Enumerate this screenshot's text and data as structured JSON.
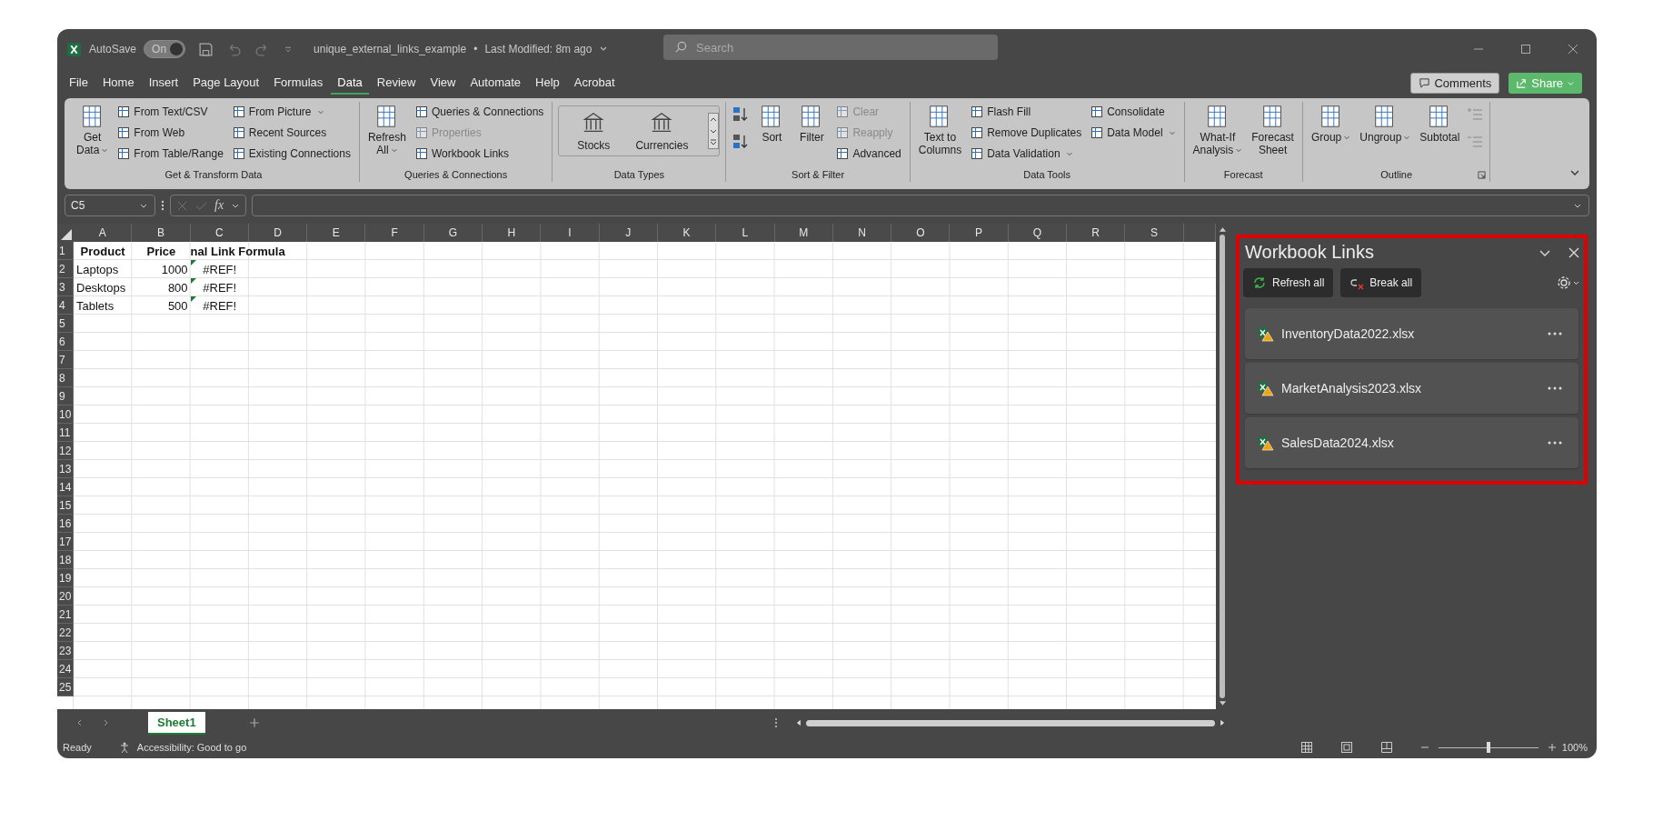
{
  "title_bar": {
    "autosave_label": "AutoSave",
    "autosave": {
      "label": "On",
      "on": true
    },
    "file_name": "unique_external_links_example",
    "separator": "•",
    "modified": "Last Modified: 8m ago",
    "search": {
      "placeholder": "Search"
    }
  },
  "menu_tabs": [
    {
      "label": "File",
      "selected": false
    },
    {
      "label": "Home",
      "selected": false
    },
    {
      "label": "Insert",
      "selected": false
    },
    {
      "label": "Page Layout",
      "selected": false
    },
    {
      "label": "Formulas",
      "selected": false
    },
    {
      "label": "Data",
      "selected": true
    },
    {
      "label": "Review",
      "selected": false
    },
    {
      "label": "View",
      "selected": false
    },
    {
      "label": "Automate",
      "selected": false
    },
    {
      "label": "Help",
      "selected": false
    },
    {
      "label": "Acrobat",
      "selected": false
    }
  ],
  "comments": "Comments",
  "share": "Share",
  "ribbon": [
    {
      "label": "Get & Transform Data",
      "columns": [
        {
          "kind": "large",
          "items": [
            {
              "label": "Get\nData",
              "dropdown": true
            }
          ]
        },
        {
          "kind": "small",
          "items": [
            {
              "label": "From Text/CSV"
            },
            {
              "label": "From Web"
            },
            {
              "label": "From Table/Range"
            }
          ]
        },
        {
          "kind": "small",
          "items": [
            {
              "label": "From Picture",
              "dropdown": true
            },
            {
              "label": "Recent Sources"
            },
            {
              "label": "Existing Connections"
            }
          ]
        }
      ]
    },
    {
      "label": "Queries & Connections",
      "columns": [
        {
          "kind": "large",
          "items": [
            {
              "label": "Refresh\nAll",
              "dropdown": true
            }
          ]
        },
        {
          "kind": "small",
          "items": [
            {
              "label": "Queries & Connections"
            },
            {
              "label": "Properties",
              "disabled": true
            },
            {
              "label": "Workbook Links"
            }
          ]
        }
      ]
    },
    {
      "label": "Data Types",
      "columns": [
        {
          "kind": "gallery",
          "items": [
            {
              "label": "Stocks"
            },
            {
              "label": "Currencies"
            }
          ]
        }
      ]
    },
    {
      "label": "Sort & Filter",
      "columns": [
        {
          "kind": "sort-icons"
        },
        {
          "kind": "large",
          "items": [
            {
              "label": "Sort"
            }
          ]
        },
        {
          "kind": "large",
          "items": [
            {
              "label": "Filter"
            }
          ]
        },
        {
          "kind": "small",
          "items": [
            {
              "label": "Clear",
              "disabled": true
            },
            {
              "label": "Reapply",
              "disabled": true
            },
            {
              "label": "Advanced"
            }
          ]
        }
      ]
    },
    {
      "label": "Data Tools",
      "columns": [
        {
          "kind": "large",
          "items": [
            {
              "label": "Text to\nColumns"
            }
          ]
        },
        {
          "kind": "small",
          "items": [
            {
              "label": "Flash Fill"
            },
            {
              "label": "Remove Duplicates"
            },
            {
              "label": "Data Validation",
              "dropdown": true
            }
          ]
        },
        {
          "kind": "small",
          "items": [
            {
              "label": "Consolidate"
            },
            {
              "label": "Data Model",
              "dropdown": true
            }
          ]
        }
      ]
    },
    {
      "label": "Forecast",
      "columns": [
        {
          "kind": "large",
          "items": [
            {
              "label": "What-If\nAnalysis",
              "dropdown": true
            }
          ]
        },
        {
          "kind": "large",
          "items": [
            {
              "label": "Forecast\nSheet"
            }
          ]
        }
      ]
    },
    {
      "label": "Outline",
      "launcher": true,
      "columns": [
        {
          "kind": "large",
          "items": [
            {
              "label": "Group",
              "dropdown": true
            }
          ]
        },
        {
          "kind": "large",
          "items": [
            {
              "label": "Ungroup",
              "dropdown": true
            }
          ]
        },
        {
          "kind": "large",
          "items": [
            {
              "label": "Subtotal"
            }
          ]
        },
        {
          "kind": "outline-icons"
        }
      ]
    }
  ],
  "formula_bar": {
    "name_box": "C5",
    "function_label": "fx"
  },
  "sheet": {
    "columns": [
      "A",
      "B",
      "C",
      "D",
      "E",
      "F",
      "G",
      "H",
      "I",
      "J",
      "K",
      "L",
      "M",
      "N",
      "O",
      "P",
      "Q",
      "R",
      "S"
    ],
    "rows": [
      {
        "label": "1",
        "cells": [
          {
            "text": "Product",
            "kind": "heading"
          },
          {
            "text": "Price",
            "kind": "heading"
          },
          {
            "text": "nal Link Formula",
            "kind": "heading-spill"
          }
        ]
      },
      {
        "label": "2",
        "cells": [
          {
            "text": "Laptops",
            "kind": "text"
          },
          {
            "text": "1000",
            "kind": "number"
          },
          {
            "text": "#REF!",
            "kind": "error"
          }
        ]
      },
      {
        "label": "3",
        "cells": [
          {
            "text": "Desktops",
            "kind": "text"
          },
          {
            "text": "800",
            "kind": "number"
          },
          {
            "text": "#REF!",
            "kind": "error"
          }
        ]
      },
      {
        "label": "4",
        "cells": [
          {
            "text": "Tablets",
            "kind": "text"
          },
          {
            "text": "500",
            "kind": "number"
          },
          {
            "text": "#REF!",
            "kind": "error"
          }
        ]
      },
      {
        "label": "5"
      },
      {
        "label": "6"
      },
      {
        "label": "7"
      },
      {
        "label": "8"
      },
      {
        "label": "9"
      },
      {
        "label": "10"
      },
      {
        "label": "11"
      },
      {
        "label": "12"
      },
      {
        "label": "13"
      },
      {
        "label": "14"
      },
      {
        "label": "15"
      },
      {
        "label": "16"
      },
      {
        "label": "17"
      },
      {
        "label": "18"
      },
      {
        "label": "19"
      },
      {
        "label": "20"
      },
      {
        "label": "21"
      },
      {
        "label": "22"
      },
      {
        "label": "23"
      },
      {
        "label": "24"
      },
      {
        "label": "25"
      }
    ]
  },
  "sheet_tabs": [
    {
      "label": "Sheet1",
      "selected": true
    }
  ],
  "status": {
    "ready": "Ready",
    "accessibility": "Accessibility: Good to go",
    "zoom": "100%",
    "zoom_slider": {
      "level": 0.5
    }
  },
  "panel": {
    "title": "Workbook Links",
    "highlighted": true,
    "buttons": [
      {
        "label": "Refresh all",
        "kind": "refresh"
      },
      {
        "label": "Break all",
        "kind": "break"
      }
    ],
    "links": [
      {
        "name": "InventoryData2022.xlsx"
      },
      {
        "name": "MarketAnalysis2023.xlsx"
      },
      {
        "name": "SalesData2024.xlsx"
      }
    ]
  }
}
